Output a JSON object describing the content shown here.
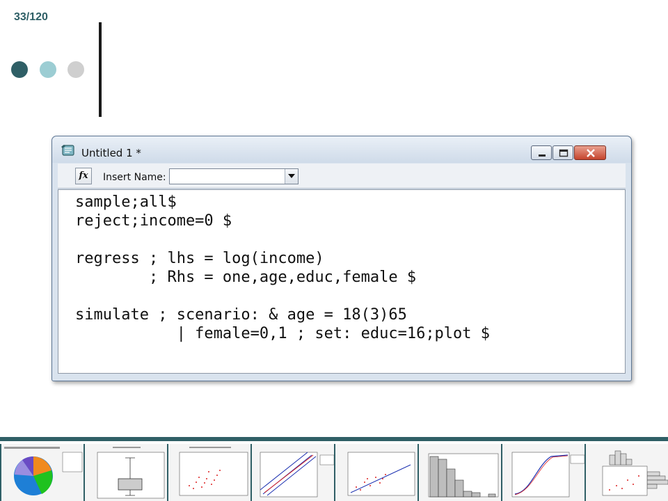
{
  "slide": {
    "number": "33/120"
  },
  "window": {
    "title": "Untitled 1 *",
    "insert_name_label": "Insert Name:",
    "insert_name_value": "",
    "fx_label": "fx",
    "code": [
      "sample;all$",
      "reject;income=0 $",
      "",
      "regress ; lhs = log(income)",
      "        ; Rhs = one,age,educ,female $",
      "",
      "simulate ; scenario: & age = 18(3)65",
      "           | female=0,1 ; set: educ=16;plot $"
    ]
  },
  "icons": {
    "app": "notepad-icon",
    "minimize": "minimize-icon",
    "maximize": "maximize-icon",
    "close": "close-icon",
    "dropdown": "chevron-down-icon"
  },
  "colors": {
    "accent": "#2f5f66",
    "accent_light": "#9ccdd3",
    "gray": "#cfcfcf",
    "close_red": "#c5452d"
  }
}
